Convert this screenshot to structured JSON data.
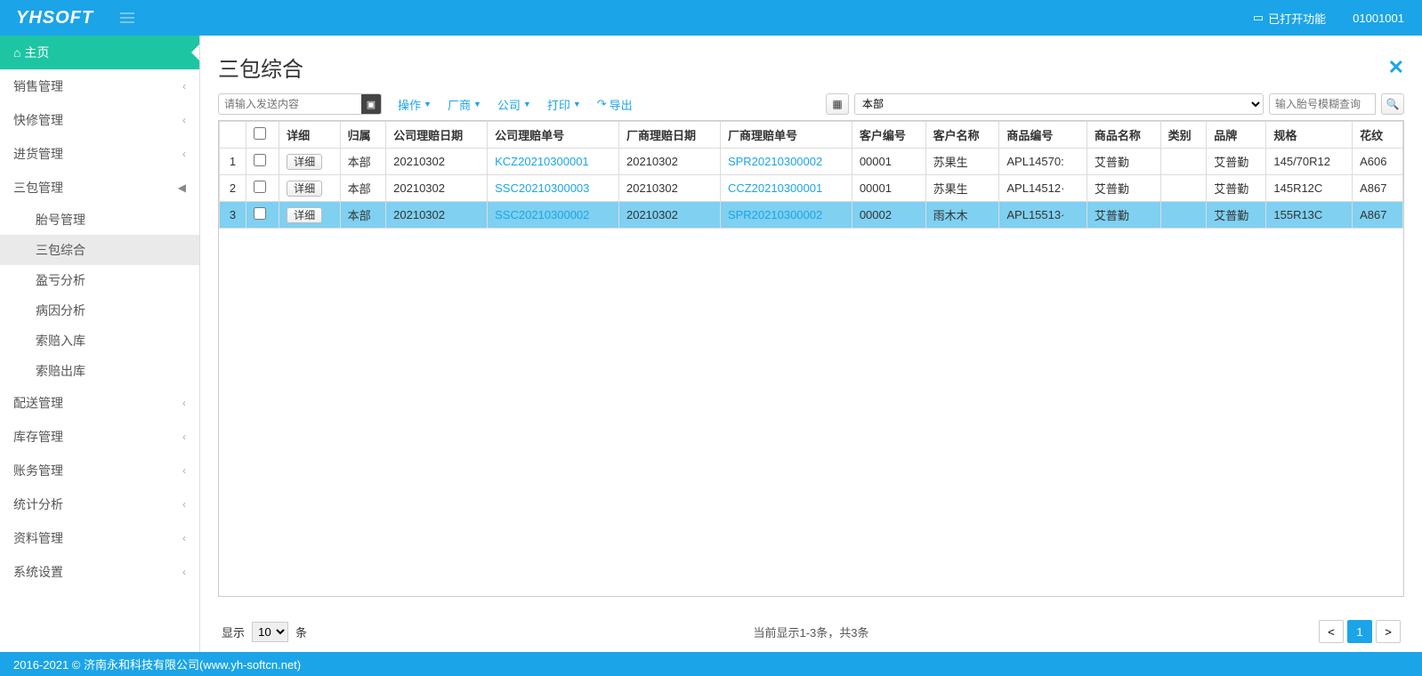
{
  "header": {
    "logo": "YHSOFT",
    "func_label": "已打开功能",
    "user_code": "01001001"
  },
  "sidebar": {
    "home": "主页",
    "items": [
      {
        "label": "销售管理"
      },
      {
        "label": "快修管理"
      },
      {
        "label": "进货管理"
      },
      {
        "label": "三包管理",
        "expanded": true,
        "subs": [
          {
            "label": "胎号管理"
          },
          {
            "label": "三包综合",
            "active": true
          },
          {
            "label": "盈亏分析"
          },
          {
            "label": "病因分析"
          },
          {
            "label": "索赔入库"
          },
          {
            "label": "索赔出库"
          }
        ]
      },
      {
        "label": "配送管理"
      },
      {
        "label": "库存管理"
      },
      {
        "label": "账务管理"
      },
      {
        "label": "统计分析"
      },
      {
        "label": "资料管理"
      },
      {
        "label": "系统设置"
      }
    ]
  },
  "page": {
    "title": "三包综合"
  },
  "toolbar": {
    "send_placeholder": "请输入发送内容",
    "action": "操作",
    "vendor": "厂商",
    "company": "公司",
    "print": "打印",
    "export": "导出",
    "dept_selected": "本部",
    "search_placeholder": "输入胎号模糊查询"
  },
  "columns": [
    "",
    "",
    "详细",
    "归属",
    "公司理赔日期",
    "公司理赔单号",
    "厂商理赔日期",
    "厂商理赔单号",
    "客户编号",
    "客户名称",
    "商品编号",
    "商品名称",
    "类别",
    "品牌",
    "规格",
    "花纹"
  ],
  "rows": [
    {
      "n": "1",
      "detail": "详细",
      "owner": "本部",
      "cdate": "20210302",
      "cno": "KCZ20210300001",
      "vdate": "20210302",
      "vno": "SPR20210300002",
      "cust": "00001",
      "cname": "苏果生",
      "pcode": "APL14570:",
      "pname": "艾普勤",
      "cat": "",
      "brand": "艾普勤",
      "spec": "145/70R12",
      "pat": "A606"
    },
    {
      "n": "2",
      "detail": "详细",
      "owner": "本部",
      "cdate": "20210302",
      "cno": "SSC20210300003",
      "vdate": "20210302",
      "vno": "CCZ20210300001",
      "cust": "00001",
      "cname": "苏果生",
      "pcode": "APL14512·",
      "pname": "艾普勤",
      "cat": "",
      "brand": "艾普勤",
      "spec": "145R12C",
      "pat": "A867"
    },
    {
      "n": "3",
      "detail": "详细",
      "owner": "本部",
      "cdate": "20210302",
      "cno": "SSC20210300002",
      "vdate": "20210302",
      "vno": "SPR20210300002",
      "cust": "00002",
      "cname": "雨木木",
      "pcode": "APL15513·",
      "pname": "艾普勤",
      "cat": "",
      "brand": "艾普勤",
      "spec": "155R13C",
      "pat": "A867",
      "selected": true
    }
  ],
  "footer": {
    "show": "显示",
    "page_size": "10",
    "unit": "条",
    "info": "当前显示1-3条，共3条",
    "prev": "<",
    "page": "1",
    "next": ">"
  },
  "copyright": "2016-2021 © 济南永和科技有限公司(www.yh-softcn.net)"
}
